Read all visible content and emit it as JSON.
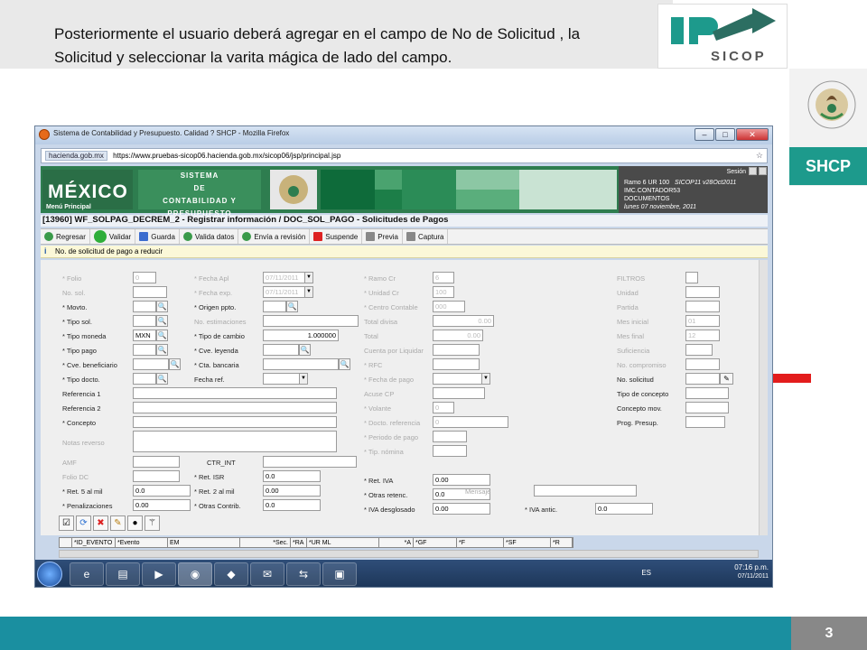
{
  "slide": {
    "caption": "Posteriormente  el usuario  deberá  agregar  en el campo de No de Solicitud ,  la  Solicitud   y  seleccionar  la  varita  mágica de lado del campo.",
    "logo_text": "SICOP",
    "brand": "SHCP",
    "page_number": "3",
    "colors": {
      "teal": "#1d9a8c",
      "bottom_band": "#1a8fa0",
      "arrow": "#e31c1c"
    }
  },
  "browser": {
    "title": "Sistema de Contabilidad y Presupuesto. Calidad ? SHCP - Mozilla Firefox",
    "site_badge": "hacienda.gob.mx",
    "url": "https://www.pruebas-sicop06.hacienda.gob.mx/sicop06/jsp/principal.jsp",
    "window_buttons": [
      "minimize-icon",
      "maximize-icon",
      "close-icon"
    ]
  },
  "app_header": {
    "mexico": "MÉXICO",
    "menu": "Menú Principal",
    "sistema_l1": "SISTEMA",
    "sistema_l2": "DE",
    "sistema_l3": "CONTABILIDAD Y PRESUPUESTO",
    "sesion": "Sesión",
    "info_l1": "Ramo  6  UR 100",
    "info_l1b": "SICOP11  v28Oct2011",
    "info_l2": "IMC.CONTADOR53",
    "info_l3": "DOCUMENTOS",
    "info_l4": "lunes 07 noviembre, 2011"
  },
  "form_title": "[13960]  WF_SOLPAG_DECREM_2 - Registrar información / DOC_SOL_PAGO - Solicitudes de Pagos",
  "toolbar": [
    "Regresar",
    "Validar",
    "Guarda",
    "Valida datos",
    "Envía a revisión",
    "Suspende",
    "Previa",
    "Captura"
  ],
  "message": "No. de solicitud de pago a reducir",
  "col1": {
    "folio": "* Folio",
    "folio_val": "0",
    "no_sol": "No. sol.",
    "movto": "* Movto.",
    "tipo_sol": "* Tipo sol.",
    "tipo_moneda": "* Tipo moneda",
    "tipo_moneda_val": "MXN",
    "tipo_pago": "* Tipo pago",
    "cve_benef": "* Cve. beneficiario",
    "tipo_docto": "* Tipo docto.",
    "referencia1": "Referencia 1",
    "referencia2": "Referencia 2",
    "concepto": "* Concepto",
    "notas": "Notas reverso",
    "amf": "AMF",
    "folio_dc": "Folio DC",
    "ret5": "* Ret. 5 al mil",
    "ret5_val": "0.0",
    "penal": "* Penalizaciones",
    "penal_val": "0.00"
  },
  "col2": {
    "fecha_apl": "* Fecha Apl",
    "fecha_apl_val": "07/11/2011",
    "fecha_exp": "* Fecha exp.",
    "fecha_exp_val": "07/11/2011",
    "origen": "* Origen ppto.",
    "no_est": "No. estimaciones",
    "tipo_cambio": "* Tipo de cambio",
    "tipo_cambio_val": "1.000000",
    "cve_leyenda": "* Cve. leyenda",
    "cta_bancaria": "* Cta. bancaria",
    "fecha_ref": "Fecha ref.",
    "ctr_int": "CTR_INT",
    "ret_isr": "* Ret. ISR",
    "ret_isr_val": "0.0",
    "ret2": "* Ret. 2 al mil",
    "ret2_val": "0.00",
    "otras_contrib": "* Otras Contrib.",
    "otras_contrib_val": "0.0"
  },
  "col3": {
    "ramo": "* Ramo Cr",
    "ramo_val": "6",
    "unidad": "* Unidad Cr",
    "unidad_val": "100",
    "centro": "* Centro Contable",
    "centro_val": "000",
    "total_divisa": "Total divisa",
    "total_divisa_val": "0.00",
    "total": "Total",
    "total_val": "0.00",
    "cuenta_liq": "Cuenta por Liquidar",
    "rfc": "* RFC",
    "fecha_pago": "* Fecha de pago",
    "acuse": "Acuse CP",
    "volante": "* Volante",
    "volante_val": "0",
    "docto_ref": "* Docto. referencia",
    "docto_ref_val": "0",
    "periodo": "* Periodo de pago",
    "tip_nomina": "* Tip. nómina",
    "ret_iva": "* Ret. IVA",
    "ret_iva_val": "0.00",
    "otras_retenc": "* Otras retenc.",
    "otras_retenc_val": "0.0",
    "mensaje": "Mensaje",
    "iva_desg": "* IVA desglosado",
    "iva_desg_val": "0.00",
    "iva_antic": "* IVA antic.",
    "iva_antic_val": "0.0"
  },
  "col4": {
    "filtros": "FILTROS",
    "unidad": "Unidad",
    "partida": "Partida",
    "mes_inicial": "Mes inicial",
    "mes_inicial_val": "01",
    "mes_final": "Mes final",
    "mes_final_val": "12",
    "suficiencia": "Suficiencia",
    "no_compromiso": "No. compromiso",
    "no_solicitud": "No. solicitud",
    "tipo_concepto": "Tipo de concepto",
    "concepto_mov": "Concepto mov.",
    "prog_presup": "Prog. Presup."
  },
  "grid_headers": [
    "*ID_EVENTO",
    "*Evento",
    "EM",
    "*Sec.",
    "*RA",
    "*UR ML",
    "*A",
    "*GF",
    "*F",
    "*SF",
    "*R"
  ],
  "taskbar": {
    "lang": "ES",
    "time": "07:16 p.m.",
    "date": "07/11/2011"
  }
}
